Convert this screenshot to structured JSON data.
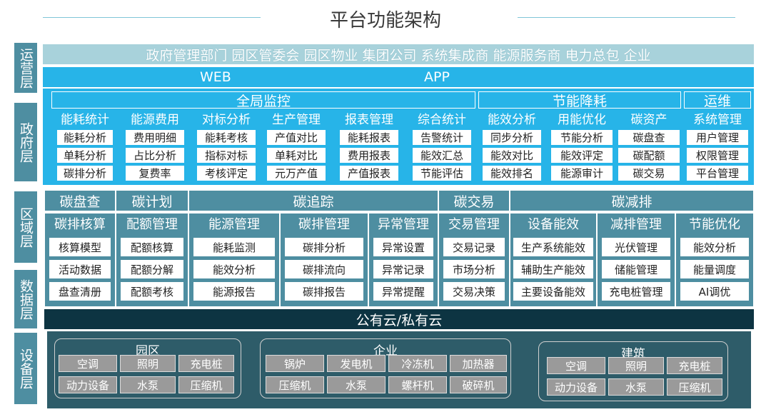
{
  "title": "平台功能架构",
  "layers": {
    "ops": "运营层",
    "gov": "政府层",
    "region": "区域层",
    "data": "数据层",
    "device": "设备层"
  },
  "operators": "政府管理部门 园区管委会 园区物业 集团公司 系统集成商 能源服务商 电力总包 企业",
  "channels": {
    "web": "WEB",
    "app": "APP"
  },
  "gov": {
    "sections": [
      "全局监控",
      "节能降耗",
      "运维"
    ],
    "columns": [
      {
        "title": "能耗统计",
        "items": [
          "能耗分析",
          "单耗分析",
          "碳排分析"
        ]
      },
      {
        "title": "能源费用",
        "items": [
          "费用明细",
          "占比分析",
          "复费率"
        ]
      },
      {
        "title": "对标分析",
        "items": [
          "能耗考核",
          "指标对标",
          "考核评定"
        ]
      },
      {
        "title": "生产管理",
        "items": [
          "产值对比",
          "单耗对比",
          "元万产值"
        ]
      },
      {
        "title": "报表管理",
        "items": [
          "能耗报表",
          "费用报表",
          "产值报表"
        ]
      },
      {
        "title": "综合统计",
        "items": [
          "告警统计",
          "能效汇总",
          "节能评估"
        ]
      },
      {
        "title": "能效分析",
        "items": [
          "同步分析",
          "能效对比",
          "能效排名"
        ]
      },
      {
        "title": "用能优化",
        "items": [
          "节能分析",
          "能效评定",
          "能源审计"
        ]
      },
      {
        "title": "碳资产",
        "items": [
          "碳盘查",
          "碳配额",
          "碳交易"
        ]
      },
      {
        "title": "系统管理",
        "items": [
          "用户管理",
          "权限管理",
          "平台管理"
        ]
      }
    ]
  },
  "region": {
    "sections": [
      "碳盘查",
      "碳计划",
      "碳追踪",
      "碳交易",
      "碳减排"
    ],
    "columns": [
      {
        "title": "碳排核算",
        "items": [
          "核算模型",
          "活动数据",
          "盘查清册"
        ]
      },
      {
        "title": "配额管理",
        "items": [
          "配额核算",
          "配额分解",
          "配额考核"
        ]
      },
      {
        "title": "能源管理",
        "items": [
          "能耗监测",
          "能效分析",
          "能源报告"
        ]
      },
      {
        "title": "碳排管理",
        "items": [
          "碳排分析",
          "碳排流向",
          "碳排报告"
        ]
      },
      {
        "title": "异常管理",
        "items": [
          "异常设置",
          "异常记录",
          "异常提醒"
        ]
      },
      {
        "title": "交易管理",
        "items": [
          "交易记录",
          "市场分析",
          "交易决策"
        ]
      },
      {
        "title": "设备能效",
        "items": [
          "生产系统能效",
          "辅助生产能效",
          "主要设备能效"
        ]
      },
      {
        "title": "减排管理",
        "items": [
          "光伏管理",
          "储能管理",
          "充电桩管理"
        ]
      },
      {
        "title": "节能优化",
        "items": [
          "能效分析",
          "能量调度",
          "AI调优"
        ]
      }
    ]
  },
  "cloud": "公有云/私有云",
  "devices": {
    "park": {
      "title": "园区",
      "items": [
        "空调",
        "照明",
        "充电桩",
        "动力设备",
        "水泵",
        "压缩机"
      ]
    },
    "enterprise": {
      "title": "企业",
      "items": [
        "锅炉",
        "发电机",
        "冷冻机",
        "加热器",
        "压缩机",
        "水泵",
        "螺杆机",
        "破碎机"
      ]
    },
    "building": {
      "title": "建筑",
      "items": [
        "空调",
        "照明",
        "充电桩",
        "动力设备",
        "水泵",
        "压缩机"
      ]
    }
  },
  "colors": {
    "blue": "#27b4e8",
    "teal": "#4e8ea1",
    "light_teal": "#a8d2db",
    "dark": "#0d3442",
    "device_bg": "#2e5c69",
    "gray_box": "#9a9a9a"
  }
}
